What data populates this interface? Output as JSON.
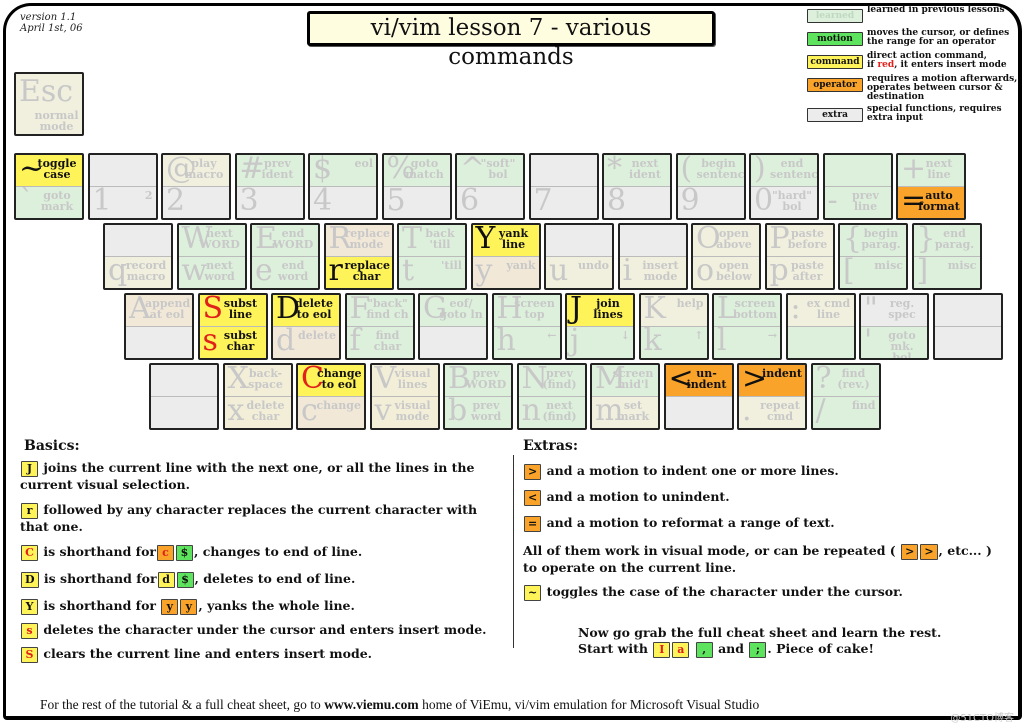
{
  "header": {
    "version": "version 1.1",
    "date": "April 1st, 06",
    "title": "vi/vim lesson 7 - various commands"
  },
  "legend": [
    {
      "box": "learned",
      "text": "learned in previous lessons",
      "color": "#dcf0dc"
    },
    {
      "box": "motion",
      "text": "moves the cursor, or defines the range for an operator",
      "color": "#5de35d"
    },
    {
      "box": "command",
      "text_a": "direct action command,",
      "text_b": "if",
      "text_red": "red",
      "text_c": ", it enters insert mode",
      "color": "#fff35a"
    },
    {
      "box": "operator",
      "text": "requires a motion afterwards, operates between cursor & destination",
      "color": "#f9a32a"
    },
    {
      "box": "extra",
      "text": "special functions, requires extra input",
      "color": "#ececec"
    }
  ],
  "keys": {
    "esc": {
      "big": "Esc",
      "label": "normal mode"
    },
    "row1": [
      {
        "top": {
          "big": "~",
          "label": "toggle case"
        },
        "bot": {
          "big": "`",
          "label": "goto mark"
        }
      },
      {
        "top": {
          "big": "",
          "label": ""
        },
        "bot": {
          "big": "1",
          "label": "2"
        }
      },
      {
        "top": {
          "big": "@",
          "label": "play macro"
        },
        "bot": {
          "big": "2",
          "label": ""
        }
      },
      {
        "top": {
          "big": "#",
          "label": "prev ident"
        },
        "bot": {
          "big": "3",
          "label": ""
        }
      },
      {
        "top": {
          "big": "$",
          "label": "eol"
        },
        "bot": {
          "big": "4",
          "label": ""
        }
      },
      {
        "top": {
          "big": "%",
          "label": "goto match"
        },
        "bot": {
          "big": "5",
          "label": ""
        }
      },
      {
        "top": {
          "big": "^",
          "label": "\"soft\" bol"
        },
        "bot": {
          "big": "6",
          "label": ""
        }
      },
      {
        "top": {
          "big": "",
          "label": ""
        },
        "bot": {
          "big": "7",
          "label": ""
        }
      },
      {
        "top": {
          "big": "*",
          "label": "next ident"
        },
        "bot": {
          "big": "8",
          "label": ""
        }
      },
      {
        "top": {
          "big": "(",
          "label": "begin sentence"
        },
        "bot": {
          "big": "9",
          "label": ""
        }
      },
      {
        "top": {
          "big": ")",
          "label": "end sentence"
        },
        "bot": {
          "big": "0",
          "label": "\"hard\" bol"
        }
      },
      {
        "top": {
          "big": "",
          "label": ""
        },
        "bot": {
          "big": "-",
          "label": "prev line"
        }
      },
      {
        "top": {
          "big": "+",
          "label": "next line"
        },
        "bot": {
          "big": "=",
          "label": "auto format"
        }
      }
    ],
    "row2": [
      {
        "top": {
          "big": "",
          "label": ""
        },
        "bot": {
          "big": "q",
          "label": "record macro"
        }
      },
      {
        "top": {
          "big": "W",
          "label": "next WORD"
        },
        "bot": {
          "big": "w",
          "label": "next word"
        }
      },
      {
        "top": {
          "big": "E",
          "label": "end WORD"
        },
        "bot": {
          "big": "e",
          "label": "end word"
        }
      },
      {
        "top": {
          "big": "R",
          "label": "replace mode"
        },
        "bot": {
          "big": "r",
          "label": "replace char"
        }
      },
      {
        "top": {
          "big": "T",
          "label": "back 'till"
        },
        "bot": {
          "big": "t",
          "label": "'till"
        }
      },
      {
        "top": {
          "big": "Y",
          "label": "yank line"
        },
        "bot": {
          "big": "y",
          "label": "yank"
        }
      },
      {
        "top": {
          "big": "",
          "label": ""
        },
        "bot": {
          "big": "u",
          "label": "undo"
        }
      },
      {
        "top": {
          "big": "",
          "label": ""
        },
        "bot": {
          "big": "i",
          "label": "insert mode"
        }
      },
      {
        "top": {
          "big": "O",
          "label": "open above"
        },
        "bot": {
          "big": "o",
          "label": "open below"
        }
      },
      {
        "top": {
          "big": "P",
          "label": "paste before"
        },
        "bot": {
          "big": "p",
          "label": "paste after"
        }
      },
      {
        "top": {
          "big": "{",
          "label": "begin parag."
        },
        "bot": {
          "big": "[",
          "label": "misc"
        }
      },
      {
        "top": {
          "big": "}",
          "label": "end parag."
        },
        "bot": {
          "big": "]",
          "label": "misc"
        }
      }
    ],
    "row3": [
      {
        "top": {
          "big": "A",
          "label": "append at eol"
        },
        "bot": {
          "big": "",
          "label": ""
        }
      },
      {
        "top": {
          "big": "S",
          "label": "subst line"
        },
        "bot": {
          "big": "s",
          "label": "subst char"
        }
      },
      {
        "top": {
          "big": "D",
          "label": "delete to eol"
        },
        "bot": {
          "big": "d",
          "label": "delete"
        }
      },
      {
        "top": {
          "big": "F",
          "label": "\"back\" find ch"
        },
        "bot": {
          "big": "f",
          "label": "find char"
        }
      },
      {
        "top": {
          "big": "G",
          "label": "eof/ goto ln"
        },
        "bot": {
          "big": "",
          "label": ""
        }
      },
      {
        "top": {
          "big": "H",
          "label": "screen top"
        },
        "bot": {
          "big": "h",
          "label": "←"
        }
      },
      {
        "top": {
          "big": "J",
          "label": "join lines"
        },
        "bot": {
          "big": "j",
          "label": "↓"
        }
      },
      {
        "top": {
          "big": "K",
          "label": "help"
        },
        "bot": {
          "big": "k",
          "label": "↑"
        }
      },
      {
        "top": {
          "big": "L",
          "label": "screen bottom"
        },
        "bot": {
          "big": "l",
          "label": "→"
        }
      },
      {
        "top": {
          "big": ":",
          "label": "ex cmd line"
        },
        "bot": {
          "big": "",
          "label": ""
        }
      },
      {
        "top": {
          "big": "\"",
          "label": "reg. spec"
        },
        "bot": {
          "big": "'",
          "label": "goto mk. bol"
        }
      },
      {
        "top": {
          "big": "",
          "label": ""
        },
        "bot": {
          "big": "",
          "label": ""
        }
      }
    ],
    "row4": [
      {
        "top": {
          "big": "",
          "label": ""
        },
        "bot": {
          "big": "",
          "label": ""
        }
      },
      {
        "top": {
          "big": "X",
          "label": "back- space"
        },
        "bot": {
          "big": "x",
          "label": "delete char"
        }
      },
      {
        "top": {
          "big": "C",
          "label": "change to eol"
        },
        "bot": {
          "big": "c",
          "label": "change"
        }
      },
      {
        "top": {
          "big": "V",
          "label": "visual lines"
        },
        "bot": {
          "big": "v",
          "label": "visual mode"
        }
      },
      {
        "top": {
          "big": "B",
          "label": "prev WORD"
        },
        "bot": {
          "big": "b",
          "label": "prev word"
        }
      },
      {
        "top": {
          "big": "N",
          "label": "prev (find)"
        },
        "bot": {
          "big": "n",
          "label": "next (find)"
        }
      },
      {
        "top": {
          "big": "M",
          "label": "screen mid'l"
        },
        "bot": {
          "big": "m",
          "label": "set mark"
        }
      },
      {
        "top": {
          "big": "<",
          "label": "un- indent"
        },
        "bot": {
          "big": "",
          "label": ""
        }
      },
      {
        "top": {
          "big": ">",
          "label": "indent"
        },
        "bot": {
          "big": ".",
          "label": "repeat cmd"
        }
      },
      {
        "top": {
          "big": "?",
          "label": "find (rev.)"
        },
        "bot": {
          "big": "/",
          "label": "find"
        }
      }
    ]
  },
  "basics": {
    "heading": "Basics:",
    "items": [
      {
        "keys": [
          "J"
        ],
        "text": "joins the current line with the next one, or all the lines in the current visual selection."
      },
      {
        "keys": [
          "r"
        ],
        "text": "followed by any character replaces the current character with that one."
      },
      {
        "keys": [
          "C"
        ],
        "pre": "is shorthand for",
        "sub": [
          "c",
          "$"
        ],
        "text": ", changes to end of line."
      },
      {
        "keys": [
          "D"
        ],
        "pre": "is shorthand for",
        "sub": [
          "d",
          "$"
        ],
        "text": ", deletes to end of line."
      },
      {
        "keys": [
          "Y"
        ],
        "pre": "is shorthand for",
        "sub": [
          "y",
          "y"
        ],
        "text": ", yanks the whole line."
      },
      {
        "keys": [
          "s"
        ],
        "text": "deletes the character under the cursor and enters insert mode."
      },
      {
        "keys": [
          "S"
        ],
        "text": "clears the current line and enters insert mode."
      }
    ]
  },
  "extras": {
    "heading": "Extras:",
    "items": [
      {
        "key": ">",
        "text": "and a motion to indent one or more lines."
      },
      {
        "key": "<",
        "text": "and a motion to unindent."
      },
      {
        "key": "=",
        "text": "and a motion to reformat a range of text."
      }
    ],
    "repeat_a": "All of them work in visual mode, or can be repeated (",
    "repeat_keys": [
      ">",
      ">"
    ],
    "repeat_b": ", etc... )",
    "repeat_c": "to operate on the current line.",
    "tilde_key": "~",
    "tilde_text": "toggles the case of the character under the cursor.",
    "outro_1": "Now go grab the full cheat sheet and learn the rest.",
    "outro_2a": "Start with",
    "outro_keys": [
      "I",
      "a",
      ",",
      ";"
    ],
    "outro_and": "and",
    "outro_2b": ".  Piece of cake!"
  },
  "footer": {
    "pre": "For the rest of the tutorial & a full cheat sheet, go to",
    "link": "www.viemu.com",
    "post": "home of ViEmu, vi/vim emulation for Microsoft Visual Studio"
  },
  "watermark": "@51CTO博客"
}
